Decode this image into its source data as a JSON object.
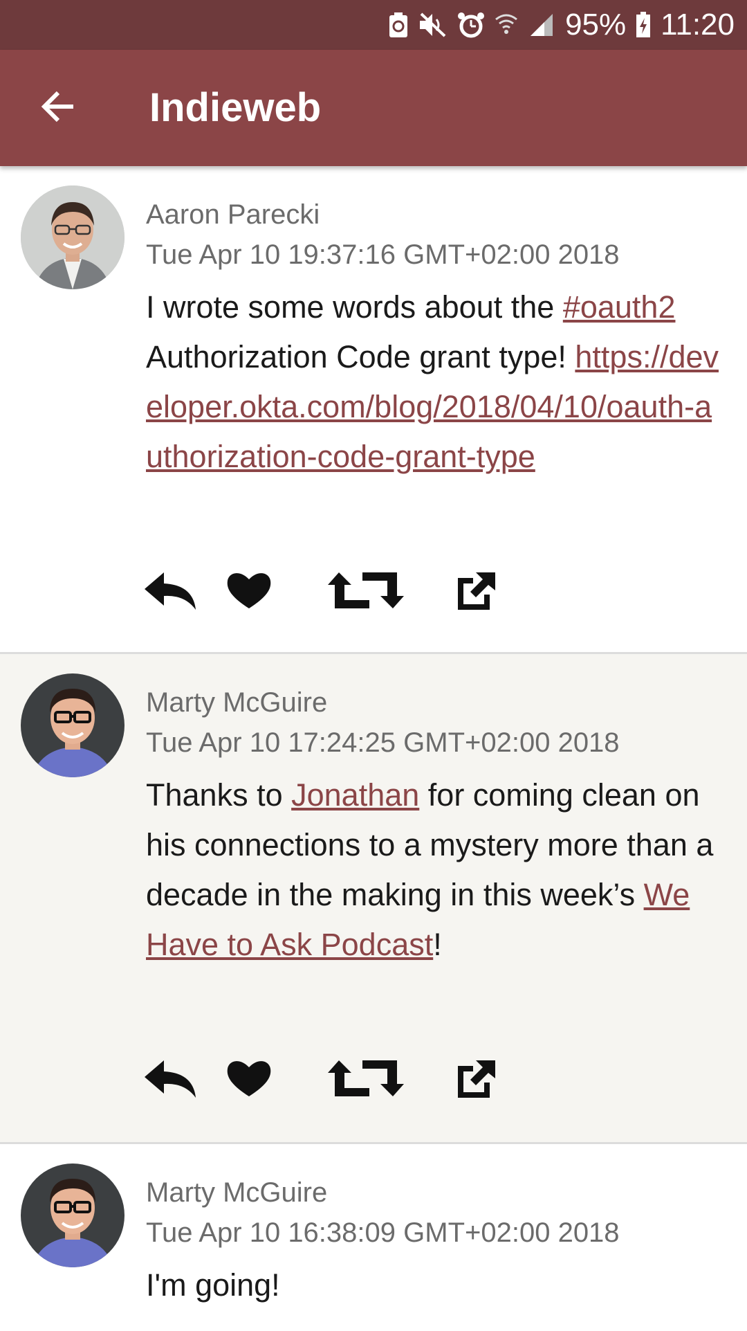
{
  "status_bar": {
    "battery_percent": "95%",
    "time": "11:20",
    "icons": [
      "sync-icon",
      "mute-icon",
      "alarm-icon",
      "wifi-icon",
      "signal-icon",
      "battery-charging-icon"
    ]
  },
  "app_bar": {
    "title": "Indieweb",
    "back_icon": "arrow-left-icon"
  },
  "posts": [
    {
      "author": "Aaron Parecki",
      "timestamp": "Tue Apr 10 19:37:16 GMT+02:00 2018",
      "text_1": "I wrote some words about the ",
      "hashtag": "#oauth2",
      "text_2": " Authorization Code grant type! ",
      "url": "https://developer.okta.com/blog/2018/04/10/oauth-authorization-code-grant-type"
    },
    {
      "author": "Marty McGuire",
      "timestamp": "Tue Apr 10 17:24:25 GMT+02:00 2018",
      "text_1": "Thanks to ",
      "link_1": "Jonathan",
      "text_2": " for coming clean on his connections to a mystery more than a decade in the making in this week’s ",
      "link_2": "We Have to Ask Podcast",
      "text_3": "!"
    },
    {
      "author": "Marty McGuire",
      "timestamp": "Tue Apr 10 16:38:09 GMT+02:00 2018",
      "text_1": "I'm going!"
    }
  ],
  "actions": {
    "icons": [
      "reply-icon",
      "like-icon",
      "repost-icon",
      "external-link-icon"
    ]
  },
  "colors": {
    "status_bar": "#6e3a3c",
    "app_bar": "#8b4547",
    "link": "#8b4547",
    "alt_background": "#f6f5f1"
  }
}
